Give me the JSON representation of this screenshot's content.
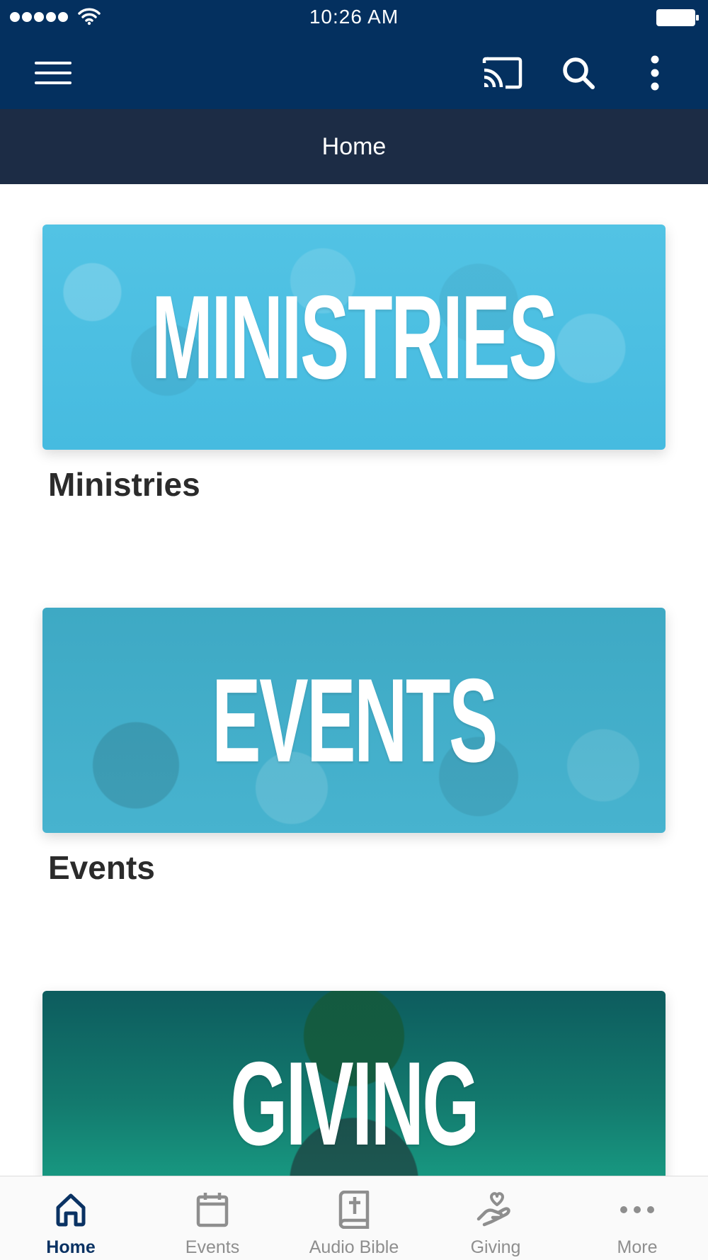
{
  "status_bar": {
    "time": "10:26 AM"
  },
  "app_bar": {
    "icons": [
      "menu-icon",
      "cast-icon",
      "search-icon",
      "more-vert-icon"
    ]
  },
  "title_bar": {
    "title": "Home"
  },
  "cards": [
    {
      "banner_text": "MINISTRIES",
      "title": "Ministries"
    },
    {
      "banner_text": "EVENTS",
      "title": "Events"
    },
    {
      "banner_text": "GIVING",
      "title": ""
    }
  ],
  "tab_bar": {
    "tabs": [
      {
        "label": "Home",
        "icon": "home-icon",
        "active": true
      },
      {
        "label": "Events",
        "icon": "calendar-icon",
        "active": false
      },
      {
        "label": "Audio Bible",
        "icon": "bible-icon",
        "active": false
      },
      {
        "label": "Giving",
        "icon": "giving-hand-icon",
        "active": false
      },
      {
        "label": "More",
        "icon": "more-horiz-icon",
        "active": false
      }
    ]
  },
  "colors": {
    "app_bar": "#04305f",
    "title_bar": "#1c2c45",
    "active_tab": "#0a3263",
    "inactive_tab": "#8e8e8e"
  }
}
